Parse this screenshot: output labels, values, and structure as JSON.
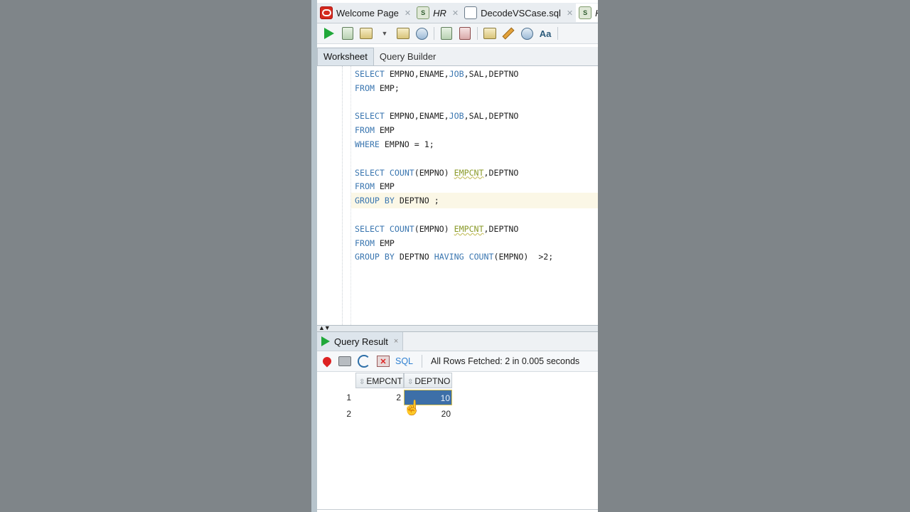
{
  "tabs": [
    {
      "label": "Welcome Page",
      "icon": "oracle-logo-icon",
      "italic": false
    },
    {
      "label": "HR",
      "icon": "sql-connection-icon",
      "italic": true
    },
    {
      "label": "DecodeVSCase.sql",
      "icon": "sql-file-icon",
      "italic": false
    },
    {
      "label": "H",
      "icon": "sql-connection-icon",
      "italic": true
    }
  ],
  "toolbar": {
    "icons": [
      "run-statement-icon",
      "run-script-icon",
      "commit-icon",
      "rollback-icon",
      "explain-plan-icon",
      "autotrace-icon",
      "sql-tuning-icon",
      "clear-icon",
      "history-icon",
      "format-icon"
    ]
  },
  "worksheet": {
    "tab_worksheet": "Worksheet",
    "tab_query_builder": "Query Builder"
  },
  "code_lines": [
    "SELECT EMPNO,ENAME,JOB,SAL,DEPTNO",
    "FROM EMP;",
    "",
    "SELECT EMPNO,ENAME,JOB,SAL,DEPTNO",
    "FROM EMP",
    "WHERE EMPNO = 1;",
    "",
    "SELECT COUNT(EMPNO) EMPCNT,DEPTNO",
    "FROM EMP",
    "GROUP BY DEPTNO ;",
    "",
    "SELECT COUNT(EMPNO) EMPCNT,DEPTNO",
    "FROM EMP",
    "GROUP BY DEPTNO HAVING COUNT(EMPNO)  >2;"
  ],
  "result": {
    "tab_label": "Query Result",
    "close": "×",
    "sql_link": "SQL",
    "status": "All Rows Fetched: 2 in 0.005 seconds",
    "columns": [
      "EMPCNT",
      "DEPTNO"
    ],
    "rows": [
      {
        "n": "1",
        "empcnt": "2",
        "deptno": "10"
      },
      {
        "n": "2",
        "empcnt": "",
        "deptno": "20"
      }
    ]
  },
  "colors": {
    "keyword": "#3a76b0",
    "selected_cell": "#3d6fa8",
    "run_green": "#20a83a"
  }
}
